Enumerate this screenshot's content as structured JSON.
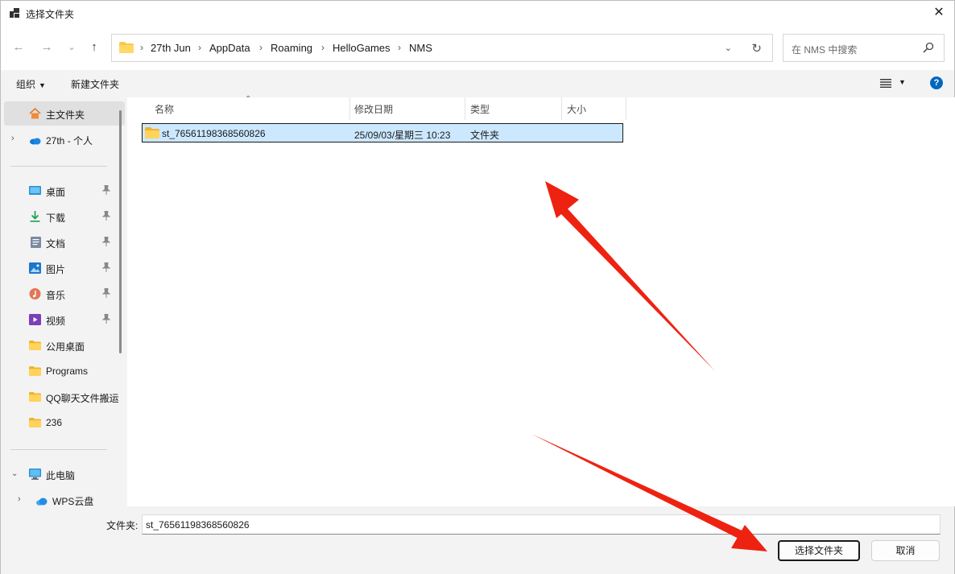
{
  "window": {
    "title": "选择文件夹"
  },
  "address": {
    "crumbs": [
      "27th Jun",
      "AppData",
      "Roaming",
      "HelloGames",
      "NMS"
    ]
  },
  "search": {
    "placeholder": "在 NMS 中搜索"
  },
  "toolbar": {
    "organize": "组织",
    "new_folder": "新建文件夹"
  },
  "sidebar": {
    "items": [
      {
        "label": "主文件夹",
        "icon": "home-icon"
      },
      {
        "label": "27th - 个人",
        "icon": "onedrive-icon"
      },
      {
        "label": "桌面",
        "icon": "desktop-icon"
      },
      {
        "label": "下载",
        "icon": "download-icon"
      },
      {
        "label": "文档",
        "icon": "document-icon"
      },
      {
        "label": "图片",
        "icon": "pictures-icon"
      },
      {
        "label": "音乐",
        "icon": "music-icon"
      },
      {
        "label": "视频",
        "icon": "videos-icon"
      },
      {
        "label": "公用桌面",
        "icon": "folder-icon"
      },
      {
        "label": "Programs",
        "icon": "folder-icon"
      },
      {
        "label": "QQ聊天文件搬运",
        "icon": "folder-icon"
      },
      {
        "label": "236",
        "icon": "folder-icon"
      },
      {
        "label": "此电脑",
        "icon": "this-pc-icon"
      },
      {
        "label": "WPS云盘",
        "icon": "wps-cloud-icon"
      }
    ]
  },
  "list": {
    "columns": [
      "名称",
      "修改日期",
      "类型",
      "大小"
    ],
    "rows": [
      {
        "name": "st_76561198368560826",
        "modified": "25/09/03/星期三 10:23",
        "type": "文件夹",
        "size": ""
      }
    ]
  },
  "footer": {
    "folder_label": "文件夹:",
    "folder_value": "st_76561198368560826",
    "select_button": "选择文件夹",
    "cancel_button": "取消"
  },
  "colors": {
    "accent": "#0067c0",
    "selection": "#cce8ff",
    "annotation_arrow": "#ee2211"
  }
}
